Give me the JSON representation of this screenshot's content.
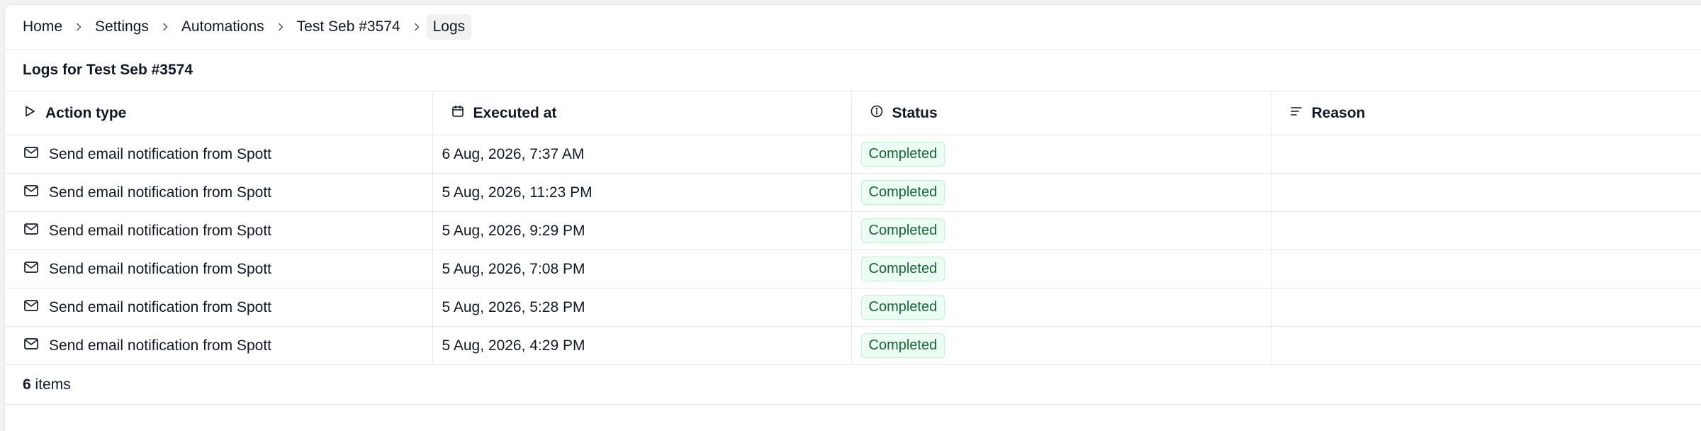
{
  "breadcrumb": {
    "items": [
      {
        "label": "Home"
      },
      {
        "label": "Settings"
      },
      {
        "label": "Automations"
      },
      {
        "label": "Test Seb #3574"
      }
    ],
    "current": "Logs",
    "separator_icon": "chevron-right-icon"
  },
  "logs": {
    "title": "Logs for Test Seb #3574",
    "columns": [
      {
        "label": "Action type",
        "icon": "play-icon"
      },
      {
        "label": "Executed at",
        "icon": "calendar-icon"
      },
      {
        "label": "Status",
        "icon": "info-icon"
      },
      {
        "label": "Reason",
        "icon": "align-left-icon"
      }
    ],
    "rows": [
      {
        "action": "Send email notification from Spott",
        "executed_at": "6 Aug, 2026, 7:37 AM",
        "status": "Completed",
        "reason": ""
      },
      {
        "action": "Send email notification from Spott",
        "executed_at": "5 Aug, 2026, 11:23 PM",
        "status": "Completed",
        "reason": ""
      },
      {
        "action": "Send email notification from Spott",
        "executed_at": "5 Aug, 2026, 9:29 PM",
        "status": "Completed",
        "reason": ""
      },
      {
        "action": "Send email notification from Spott",
        "executed_at": "5 Aug, 2026, 7:08 PM",
        "status": "Completed",
        "reason": ""
      },
      {
        "action": "Send email notification from Spott",
        "executed_at": "5 Aug, 2026, 5:28 PM",
        "status": "Completed",
        "reason": ""
      },
      {
        "action": "Send email notification from Spott",
        "executed_at": "5 Aug, 2026, 4:29 PM",
        "status": "Completed",
        "reason": ""
      }
    ],
    "row_icon": "mail-icon",
    "footer": {
      "count": "6",
      "suffix": " items"
    }
  },
  "colors": {
    "status_completed_bg": "#ecfdf3",
    "status_completed_text": "#166534",
    "status_completed_border": "#bbf7d0",
    "border": "#e5e7eb"
  }
}
